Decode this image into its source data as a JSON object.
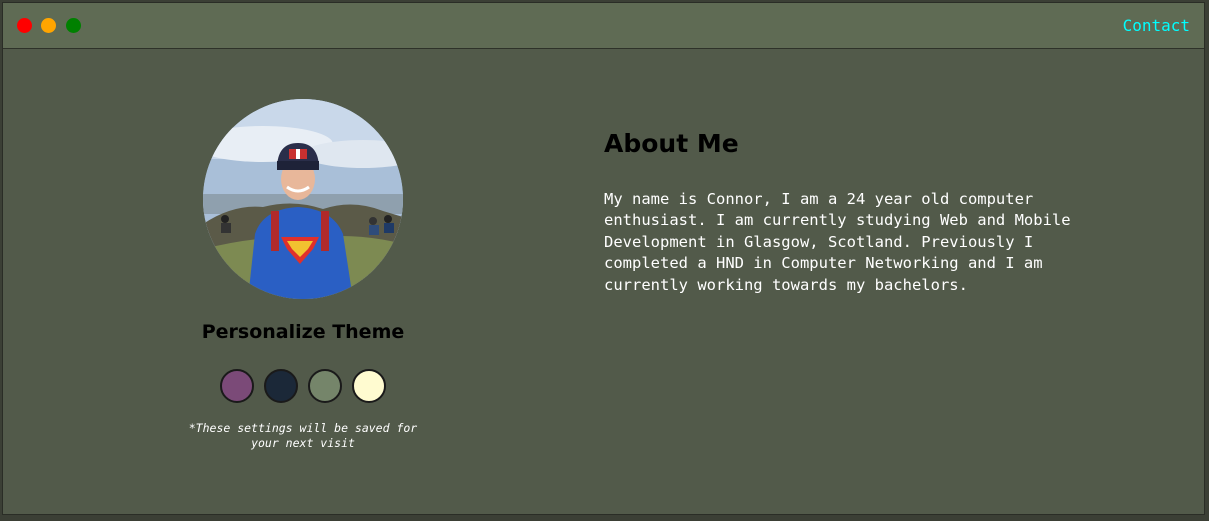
{
  "window": {
    "controls": [
      "close",
      "minimize",
      "maximize"
    ],
    "colors": {
      "close": "#ff0000",
      "minimize": "#ffa500",
      "maximize": "#008000"
    }
  },
  "nav": {
    "contact_label": "Contact",
    "contact_color": "#00ffff"
  },
  "profile": {
    "avatar_icon": "profile-photo"
  },
  "theme": {
    "title": "Personalize Theme",
    "swatches": [
      {
        "name": "purple",
        "color": "#7b4a78"
      },
      {
        "name": "navy",
        "color": "#1b2838"
      },
      {
        "name": "sage",
        "color": "#75856a"
      },
      {
        "name": "cream",
        "color": "#fffbd0"
      }
    ],
    "note": "*These settings will be saved for your next visit"
  },
  "about": {
    "title": "About Me",
    "text": "My name is Connor, I am a 24 year old computer enthusiast. I am currently studying Web and Mobile Development in Glasgow, Scotland. Previously I completed a HND in Computer Networking and I am currently working towards my bachelors."
  }
}
